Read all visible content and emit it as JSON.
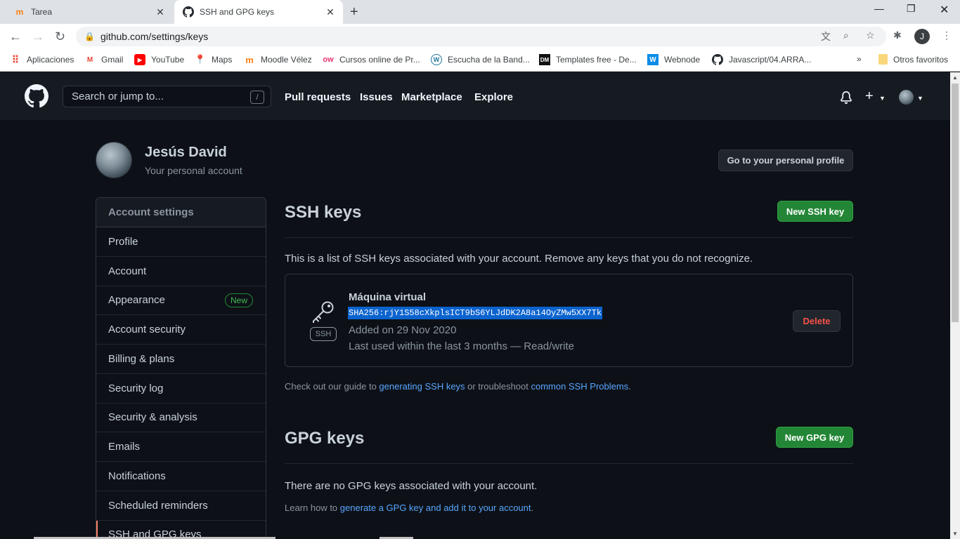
{
  "browser": {
    "tabs": [
      {
        "title": "Tarea",
        "favicon": "moodle-icon",
        "active": false
      },
      {
        "title": "SSH and GPG keys",
        "favicon": "github-icon",
        "active": true
      }
    ],
    "url": "github.com/settings/keys",
    "profile_initial": "J"
  },
  "bookmarks": [
    {
      "label": "Aplicaciones",
      "icon": "apps-grid-icon"
    },
    {
      "label": "Gmail",
      "icon": "gmail-icon"
    },
    {
      "label": "YouTube",
      "icon": "youtube-icon"
    },
    {
      "label": "Maps",
      "icon": "maps-icon"
    },
    {
      "label": "Moodle Vélez",
      "icon": "moodle-icon"
    },
    {
      "label": "Cursos online de Pr...",
      "icon": "ow-icon"
    },
    {
      "label": "Escucha de la Band...",
      "icon": "wordpress-icon"
    },
    {
      "label": "Templates free - De...",
      "icon": "dm-icon"
    },
    {
      "label": "Webnode",
      "icon": "webnode-icon"
    },
    {
      "label": "Javascript/04.ARRA...",
      "icon": "github-icon"
    },
    {
      "label": "»",
      "icon": "chevron-double-icon"
    },
    {
      "label": "Otros favoritos",
      "icon": "folder-icon"
    }
  ],
  "header": {
    "search_placeholder": "Search or jump to...",
    "search_shortcut": "/",
    "nav": [
      "Pull requests",
      "Issues",
      "Marketplace",
      "Explore"
    ]
  },
  "profile": {
    "name": "Jesús David",
    "subtitle": "Your personal account",
    "button": "Go to your personal profile"
  },
  "sidebar": {
    "heading": "Account settings",
    "items": [
      {
        "label": "Profile"
      },
      {
        "label": "Account"
      },
      {
        "label": "Appearance",
        "badge": "New"
      },
      {
        "label": "Account security"
      },
      {
        "label": "Billing & plans"
      },
      {
        "label": "Security log"
      },
      {
        "label": "Security & analysis"
      },
      {
        "label": "Emails"
      },
      {
        "label": "Notifications"
      },
      {
        "label": "Scheduled reminders"
      },
      {
        "label": "SSH and GPG keys",
        "active": true
      }
    ]
  },
  "ssh": {
    "title": "SSH keys",
    "new_button": "New SSH key",
    "description": "This is a list of SSH keys associated with your account. Remove any keys that you do not recognize.",
    "key": {
      "name": "Máquina virtual",
      "fingerprint": "SHA256:rjY1S58cXkplsICT9bS6YLJdDK2A8a14OyZMw5XX7Tk",
      "added": "Added on 29 Nov 2020",
      "last_used": "Last used within the last 3 months — Read/write",
      "type_label": "SSH",
      "delete_button": "Delete"
    },
    "guide_prefix": "Check out our guide to ",
    "guide_link1": "generating SSH keys",
    "guide_middle": " or troubleshoot ",
    "guide_link2": "common SSH Problems",
    "guide_suffix": "."
  },
  "gpg": {
    "title": "GPG keys",
    "new_button": "New GPG key",
    "empty": "There are no GPG keys associated with your account.",
    "learn_prefix": "Learn how to ",
    "learn_link": "generate a GPG key and add it to your account",
    "learn_suffix": "."
  }
}
